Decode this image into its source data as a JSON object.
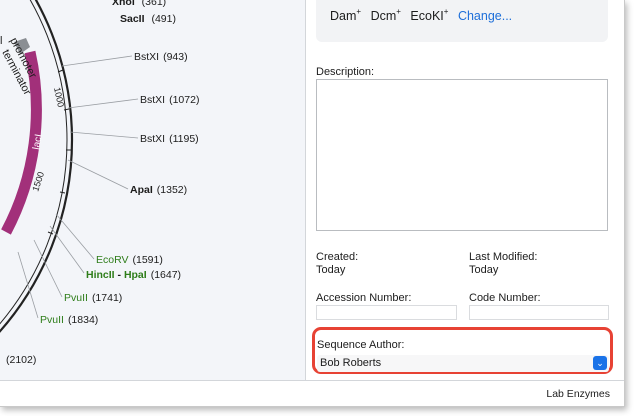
{
  "methylation": {
    "items": [
      {
        "name": "Dam",
        "sup": "+"
      },
      {
        "name": "Dcm",
        "sup": "+"
      },
      {
        "name": "EcoKI",
        "sup": "+"
      }
    ],
    "change_link": "Change..."
  },
  "map": {
    "top_enzymes": {
      "xhoi": "XhoI",
      "xhoi_pos": "(361)",
      "sacii": "SacII",
      "sacii_pos": "(491)"
    },
    "feature_labels": {
      "promoter": "promoter",
      "terminator": "terminator",
      "laci": "lacI"
    },
    "tick_labels": {
      "t1000": "1000",
      "t1500": "1500"
    },
    "enzymes": [
      {
        "name": "BstXI",
        "pos": "(943)"
      },
      {
        "name": "BstXI",
        "pos": "(1072)"
      },
      {
        "name": "BstXI",
        "pos": "(1195)"
      },
      {
        "name": "ApaI",
        "pos": "(1352)"
      },
      {
        "name": "EcoRV",
        "pos": "(1591)"
      },
      {
        "name": "HincII",
        "sep": " - ",
        "name2": "HpaI",
        "pos": "(1647)"
      },
      {
        "name": "PvuII",
        "pos": "(1741)"
      },
      {
        "name": "PvuII",
        "pos": "(1834)"
      },
      {
        "name": "",
        "pos": "(2102)"
      }
    ],
    "colors": {
      "backbone": "#222222",
      "laci": "#a2307a",
      "green": "#2e7d1a",
      "lines": "#9a9ea3"
    }
  },
  "details": {
    "description_label": "Description:",
    "created_label": "Created:",
    "created_value": "Today",
    "modified_label": "Last Modified:",
    "modified_value": "Today",
    "accession_label": "Accession Number:",
    "code_label": "Code Number:",
    "author_label": "Sequence Author:",
    "author_value": "Bob Roberts",
    "highlight_color": "#e74234"
  },
  "status_bar": {
    "right_text": "Lab Enzymes"
  }
}
